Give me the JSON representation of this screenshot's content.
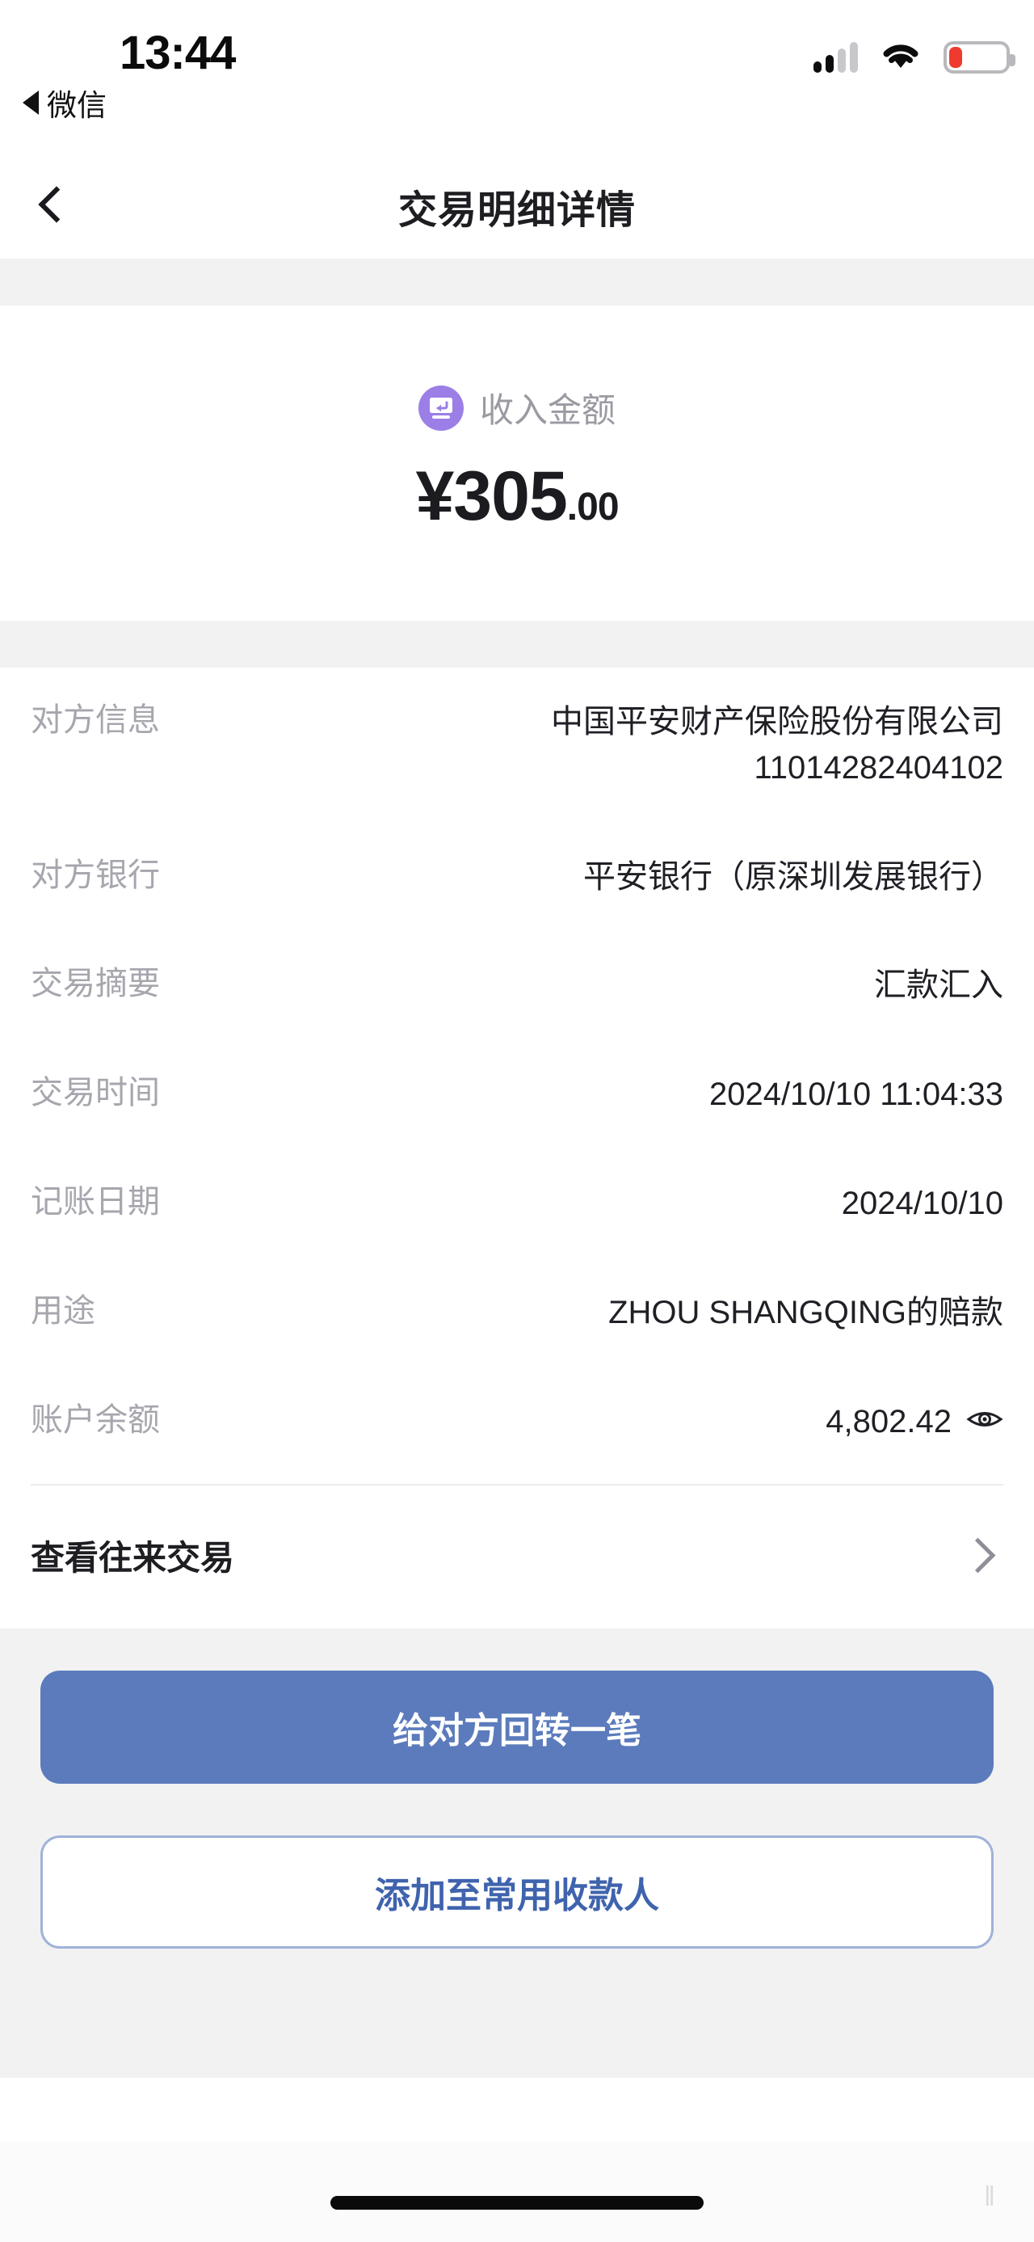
{
  "status_bar": {
    "time": "13:44",
    "return_app": "微信",
    "signal_icon": "signal-bars-icon",
    "wifi_icon": "wifi-icon",
    "battery_icon": "battery-low-icon"
  },
  "nav": {
    "back_icon": "chevron-left-icon",
    "title": "交易明细详情"
  },
  "amount": {
    "type_icon": "income-arrow-icon",
    "label": "收入金额",
    "currency_symbol": "¥",
    "integer": "305",
    "decimal": ".00",
    "full_value": "¥305.00"
  },
  "details": [
    {
      "label": "对方信息",
      "value": "中国平安财产保险股份有限公司 11014282404102"
    },
    {
      "label": "对方银行",
      "value": "平安银行（原深圳发展银行）"
    },
    {
      "label": "交易摘要",
      "value": "汇款汇入"
    },
    {
      "label": "交易时间",
      "value": "2024/10/10 11:04:33"
    },
    {
      "label": "记账日期",
      "value": "2024/10/10"
    },
    {
      "label": "用途",
      "value": "ZHOU SHANGQING的赔款"
    },
    {
      "label": "账户余额",
      "value": "4,802.42",
      "trailing_icon": "eye-icon"
    }
  ],
  "link_row": {
    "label": "查看往来交易",
    "chevron_icon": "chevron-right-icon"
  },
  "actions": {
    "primary_label": "给对方回转一笔",
    "secondary_label": "添加至常用收款人"
  },
  "colors": {
    "primary_button": "#5b7bbc",
    "secondary_text": "#3f63ad",
    "income_icon": "#9b7fe6",
    "band": "#f2f2f3",
    "battery_low": "#ef3b2f"
  },
  "home_bar": {
    "indicator": "home-indicator",
    "watermark": "‖"
  }
}
